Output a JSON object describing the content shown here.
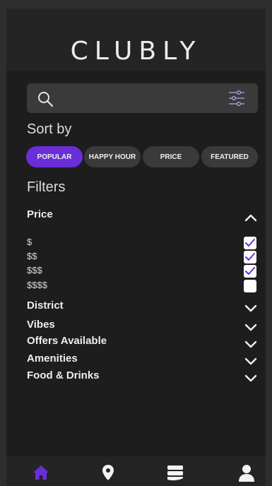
{
  "app": {
    "logo": "CLUBLY"
  },
  "search": {
    "value": "",
    "placeholder": ""
  },
  "sort": {
    "title": "Sort by",
    "options": [
      {
        "label": "POPULAR",
        "active": true
      },
      {
        "label": "HAPPY HOUR",
        "active": false
      },
      {
        "label": "PRICE",
        "active": false
      },
      {
        "label": "FEATURED",
        "active": false
      }
    ]
  },
  "filters": {
    "title": "Filters",
    "price": {
      "label": "Price",
      "expanded": true,
      "options": [
        {
          "label": "$",
          "checked": true
        },
        {
          "label": "$$",
          "checked": true
        },
        {
          "label": "$$$",
          "checked": true
        },
        {
          "label": "$$$$",
          "checked": false
        }
      ]
    },
    "sections": [
      {
        "label": "District",
        "expanded": false
      },
      {
        "label": "Vibes",
        "expanded": false
      },
      {
        "label": "Offers Available",
        "expanded": false
      },
      {
        "label": "Amenities",
        "expanded": false
      },
      {
        "label": "Food & Drinks",
        "expanded": false
      }
    ]
  },
  "nav": {
    "items": [
      {
        "icon": "home-icon",
        "active": true
      },
      {
        "icon": "map-pin-icon",
        "active": false
      },
      {
        "icon": "tickets-icon",
        "active": false
      },
      {
        "icon": "profile-icon",
        "active": false
      }
    ]
  },
  "colors": {
    "accent": "#6a2ed8",
    "background": "#1d1d1d",
    "surface": "#3a3a3a",
    "text": "#eeeeee"
  }
}
